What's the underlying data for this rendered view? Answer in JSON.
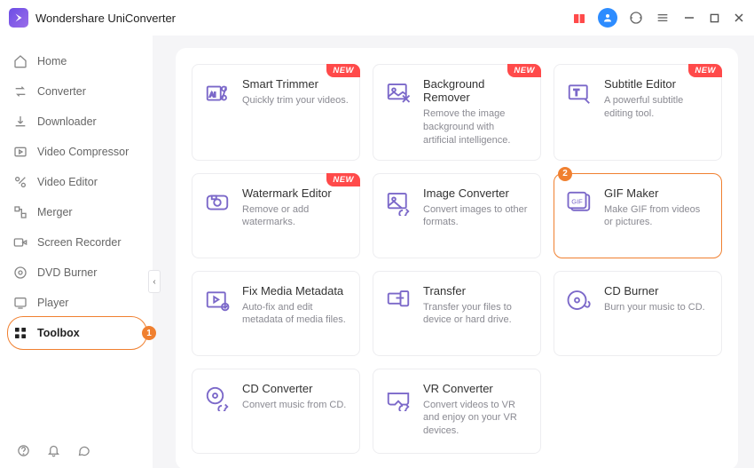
{
  "app_title": "Wondershare UniConverter",
  "sidebar": {
    "items": [
      {
        "label": "Home"
      },
      {
        "label": "Converter"
      },
      {
        "label": "Downloader"
      },
      {
        "label": "Video Compressor"
      },
      {
        "label": "Video Editor"
      },
      {
        "label": "Merger"
      },
      {
        "label": "Screen Recorder"
      },
      {
        "label": "DVD Burner"
      },
      {
        "label": "Player"
      },
      {
        "label": "Toolbox",
        "active": true,
        "badge": "1"
      }
    ]
  },
  "cards": [
    {
      "title": "Smart Trimmer",
      "desc": "Quickly trim your videos.",
      "new": true
    },
    {
      "title": "Background Remover",
      "desc": "Remove the image background with artificial intelligence.",
      "new": true
    },
    {
      "title": "Subtitle Editor",
      "desc": "A powerful subtitle editing tool.",
      "new": true
    },
    {
      "title": "Watermark Editor",
      "desc": "Remove or add watermarks.",
      "new": true
    },
    {
      "title": "Image Converter",
      "desc": "Convert images to other formats."
    },
    {
      "title": "GIF Maker",
      "desc": "Make GIF from videos or pictures.",
      "highlight": true,
      "badge": "2"
    },
    {
      "title": "Fix Media Metadata",
      "desc": "Auto-fix and edit metadata of media files."
    },
    {
      "title": "Transfer",
      "desc": "Transfer your files to device or hard drive."
    },
    {
      "title": "CD Burner",
      "desc": "Burn your music to CD."
    },
    {
      "title": "CD Converter",
      "desc": "Convert music from CD."
    },
    {
      "title": "VR Converter",
      "desc": "Convert videos to VR and enjoy on your VR devices."
    }
  ],
  "badge_new_label": "NEW"
}
